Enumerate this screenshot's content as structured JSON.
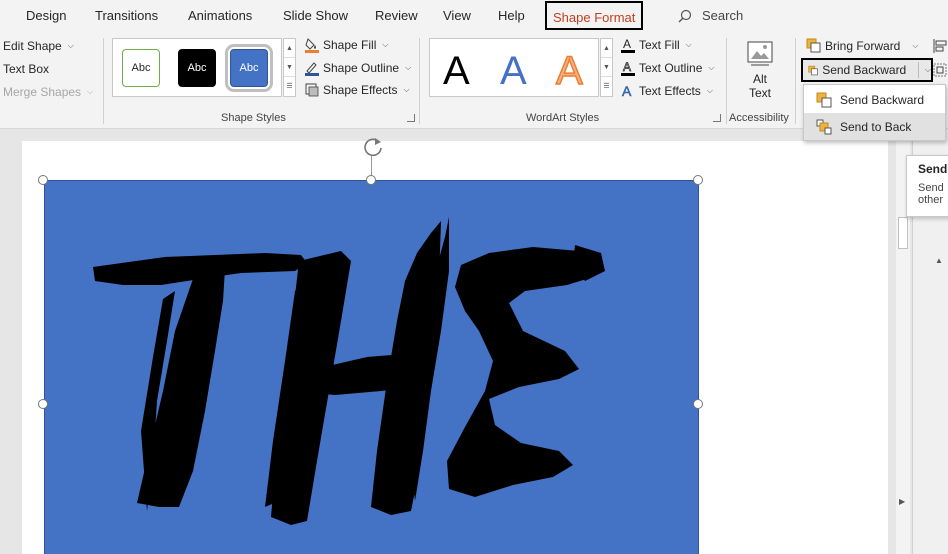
{
  "tabs": [
    {
      "label": "Design"
    },
    {
      "label": "Transitions"
    },
    {
      "label": "Animations"
    },
    {
      "label": "Slide Show"
    },
    {
      "label": "Review"
    },
    {
      "label": "View"
    },
    {
      "label": "Help"
    },
    {
      "label": "Shape Format"
    }
  ],
  "search": {
    "label": "Search",
    "icon": "search-icon"
  },
  "insert_shapes": {
    "edit_shape": "Edit Shape",
    "text_box": "Text Box",
    "merge_shapes": "Merge Shapes"
  },
  "shape_styles": {
    "label": "Shape Styles",
    "swatches": [
      {
        "text": "Abc",
        "fill": "#ffffff",
        "border": "#70ad47",
        "color": "#262626"
      },
      {
        "text": "Abc",
        "fill": "#000000",
        "border": "#000000",
        "color": "#ffffff"
      },
      {
        "text": "Abc",
        "fill": "#4472c4",
        "border": "#2f5597",
        "color": "#ffffff"
      }
    ],
    "shape_fill": "Shape Fill",
    "shape_outline": "Shape Outline",
    "shape_effects": "Shape Effects"
  },
  "wordart_styles": {
    "label": "WordArt Styles",
    "samples": [
      {
        "text": "A",
        "color": "#000000"
      },
      {
        "text": "A",
        "color": "#4472c4"
      },
      {
        "text": "A",
        "color": "#f4b183"
      }
    ],
    "text_fill": "Text Fill",
    "text_outline": "Text Outline",
    "text_effects": "Text Effects"
  },
  "accessibility": {
    "label": "Accessibility",
    "alt_text_line1": "Alt",
    "alt_text_line2": "Text"
  },
  "arrange": {
    "bring_forward": "Bring Forward",
    "send_backward": "Send Backward"
  },
  "send_backward_menu": {
    "items": [
      {
        "label": "Send Backward"
      },
      {
        "label": "Send to Back"
      }
    ]
  },
  "tooltip": {
    "title": "Send",
    "line1": "Send",
    "line2": "other"
  },
  "colors": {
    "accent": "#c43e1c",
    "shape_fill": "#4472c4",
    "ribbon_bg": "#f3f3f3"
  }
}
